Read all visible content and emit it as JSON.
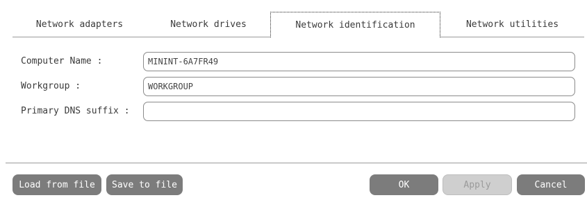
{
  "tabs": [
    {
      "label": "Network adapters"
    },
    {
      "label": "Network drives"
    },
    {
      "label": "Network identification",
      "active": true
    },
    {
      "label": "Network utilities"
    }
  ],
  "form": {
    "computer_name": {
      "label": "Computer Name :",
      "value": "MININT-6A7FR49"
    },
    "workgroup": {
      "label": "Workgroup :",
      "value": "WORKGROUP"
    },
    "dns_suffix": {
      "label": "Primary DNS suffix :",
      "value": ""
    }
  },
  "buttons": {
    "load": "Load from file",
    "save": "Save to file",
    "ok": "OK",
    "apply": "Apply",
    "cancel": "Cancel"
  },
  "colors": {
    "button_bg": "#7c7c7c",
    "button_disabled_bg": "#cfcfcf",
    "text": "#3a3a3a",
    "border": "#8a8a8a"
  }
}
